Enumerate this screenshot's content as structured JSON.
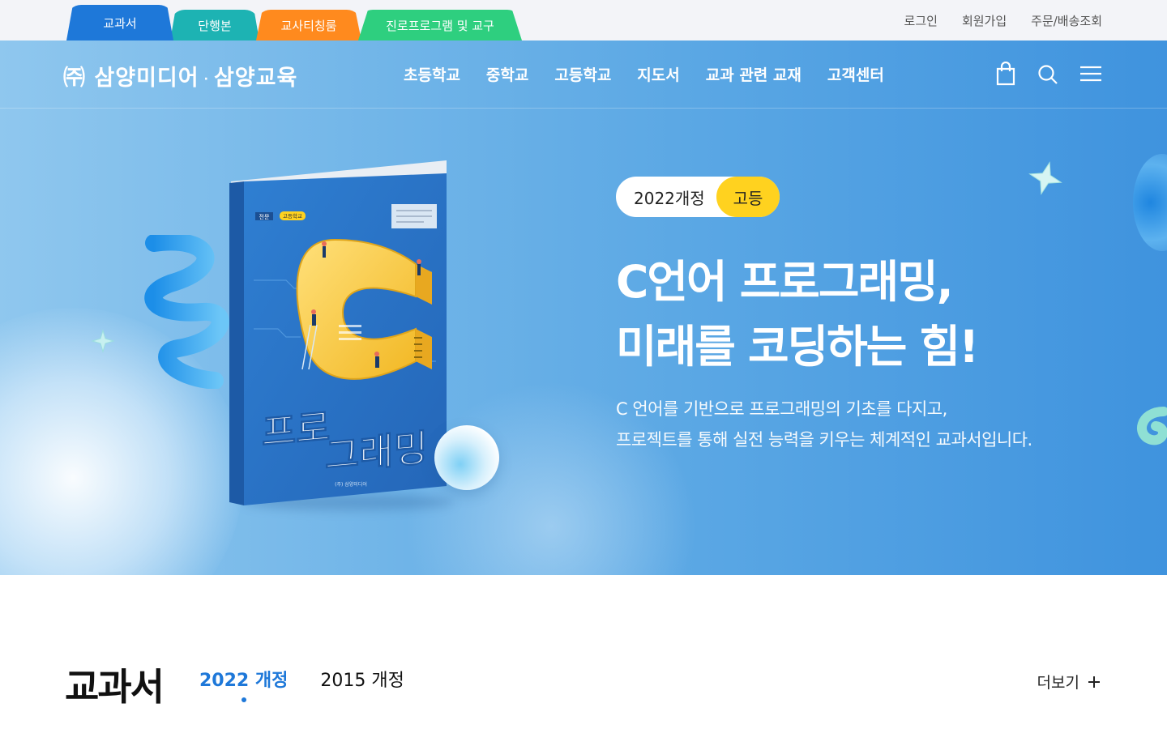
{
  "site_tabs": [
    "교과서",
    "단행본",
    "교사티칭룸",
    "진로프로그램 및 교구"
  ],
  "util_links": [
    "로그인",
    "회원가입",
    "주문/배송조회"
  ],
  "logo": {
    "part1": "㈜ 삼양미디어",
    "separator": "·",
    "part2": "삼양교육"
  },
  "menu": [
    "초등학교",
    "중학교",
    "고등학교",
    "지도서",
    "교과 관련 교재",
    "고객센터"
  ],
  "nav_icons": [
    "shopping-bag-icon",
    "search-icon",
    "hamburger-menu-icon"
  ],
  "hero": {
    "badge_left": "2022개정",
    "badge_right": "고등",
    "headline_line1": "C언어 프로그래밍,",
    "headline_line2": "미래를 코딩하는 힘!",
    "sub_line1": "C 언어를 기반으로 프로그래밍의 기초를 다지고,",
    "sub_line2": "프로젝트를 통해 실전 능력을 키우는 체계적인 교과서입니다.",
    "book": {
      "tag1": "전문",
      "tag2": "고등학교",
      "title_line1": "프로",
      "title_line2": "그래밍",
      "publisher": "(주) 삼양미디어"
    }
  },
  "section": {
    "title": "교과서",
    "tabs": [
      {
        "label": "2022 개정",
        "active": true
      },
      {
        "label": "2015 개정",
        "active": false
      }
    ],
    "more_label": "더보기",
    "more_icon": "plus-icon"
  },
  "colors": {
    "tab_blue": "#1e78d9",
    "tab_teal": "#1db3b3",
    "tab_orange": "#ff8a1e",
    "tab_green": "#2ecf7f",
    "badge_yellow": "#ffd21f",
    "hero_blue": "#5aa7e4"
  }
}
